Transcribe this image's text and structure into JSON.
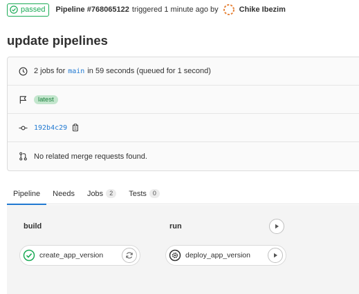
{
  "header": {
    "status": "passed",
    "pipeline_label": "Pipeline #768065122",
    "triggered_text": "triggered 1 minute ago by",
    "author": "Chike Ibezim"
  },
  "title": "update pipelines",
  "info": {
    "jobs_prefix": "2 jobs for",
    "branch": "main",
    "jobs_suffix": "in 59 seconds (queued for 1 second)",
    "latest_badge": "latest",
    "commit_sha": "192b4c29",
    "merge_requests": "No related merge requests found."
  },
  "tabs": [
    {
      "label": "Pipeline"
    },
    {
      "label": "Needs"
    },
    {
      "label": "Jobs",
      "count": "2"
    },
    {
      "label": "Tests",
      "count": "0"
    }
  ],
  "stages": [
    {
      "name": "build",
      "job": "create_app_version"
    },
    {
      "name": "run",
      "job": "deploy_app_version"
    }
  ],
  "colors": {
    "success": "#1aaa55",
    "link": "#1f78d1",
    "latest_bg": "#c3e6cd"
  }
}
